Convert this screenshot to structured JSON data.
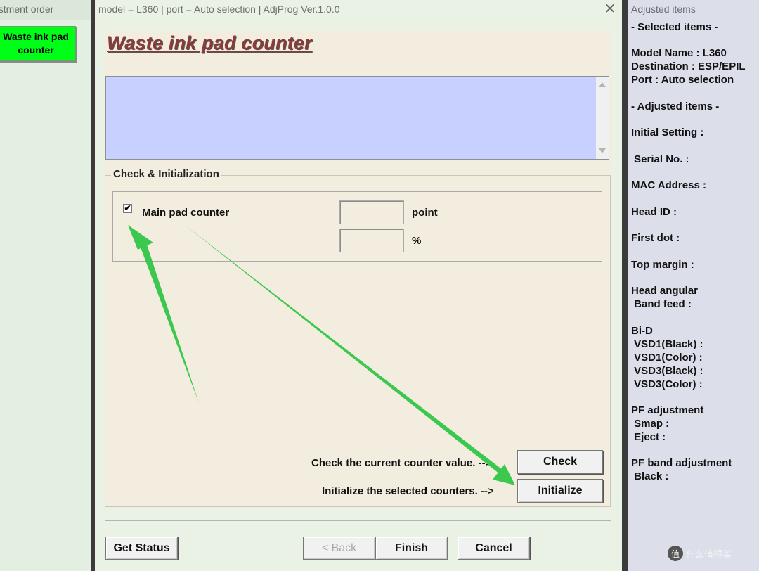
{
  "left_window": {
    "title": "ustment order",
    "waste_button": "Waste ink pad counter"
  },
  "main_window": {
    "title": "model = L360 | port = Auto selection | AdjProg Ver.1.0.0",
    "close_glyph": "✕",
    "heading": "Waste ink pad counter",
    "group_label": "Check & Initialization",
    "checkbox_label": "Main pad counter",
    "checkbox_checked": true,
    "unit_point": "point",
    "unit_percent": "%",
    "point_value": "",
    "percent_value": "",
    "check_caption": "Check the current counter value. -->",
    "init_caption": "Initialize the selected counters. -->",
    "check_button": "Check",
    "initialize_button": "Initialize",
    "get_status_button": "Get Status",
    "back_button": "< Back",
    "finish_button": "Finish",
    "cancel_button": "Cancel"
  },
  "right_window": {
    "title": "Adjusted items",
    "lines": [
      "- Selected items -",
      "Model Name : L360",
      "Destination : ESP/EPIL",
      "Port : Auto selection",
      "- Adjusted items -",
      "Initial Setting :",
      " Serial No. :",
      "MAC Address :",
      "Head ID :",
      "First dot :",
      "Top margin :",
      "Head angular",
      " Band feed :",
      "Bi-D",
      " VSD1(Black) :",
      " VSD1(Color) :",
      " VSD3(Black) :",
      " VSD3(Color) :",
      "PF adjustment",
      " Smap :",
      " Eject :",
      "PF band adjustment",
      " Black :"
    ]
  },
  "watermark": {
    "badge": "值",
    "text": "什么值得买"
  },
  "colors": {
    "waste_button_bg": "#00ff16",
    "heading": "#8b3a3a",
    "message_area": "#c7d0ff",
    "annotation_arrow": "#3cc84f"
  }
}
